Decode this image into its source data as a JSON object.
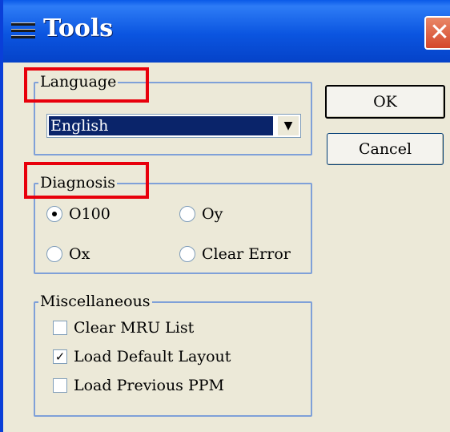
{
  "window": {
    "title": "Tools",
    "close_glyph": "✕"
  },
  "language": {
    "legend": "Language",
    "selected": "English",
    "arrow": "▼"
  },
  "diagnosis": {
    "legend": "Diagnosis",
    "options": [
      {
        "label": "O100",
        "checked": true
      },
      {
        "label": "Oy",
        "checked": false
      },
      {
        "label": "Ox",
        "checked": false
      },
      {
        "label": "Clear Error",
        "checked": false
      }
    ]
  },
  "misc": {
    "legend": "Miscellaneous",
    "items": [
      {
        "label": "Clear MRU List",
        "checked": false
      },
      {
        "label": "Load Default Layout",
        "checked": true
      },
      {
        "label": "Load Previous PPM",
        "checked": false
      }
    ]
  },
  "buttons": {
    "ok": "OK",
    "cancel": "Cancel"
  },
  "colors": {
    "highlight": "#e8000b",
    "titlebar": "#0b55e0",
    "selection": "#0a246a"
  }
}
